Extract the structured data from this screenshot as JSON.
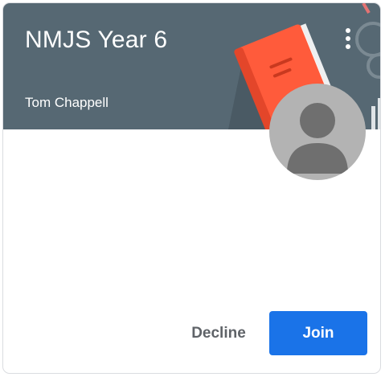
{
  "class_card": {
    "title": "NMJS Year 6",
    "teacher": "Tom Chappell",
    "banner_color": "#566873",
    "more_icon": "more-vert-icon",
    "avatar_icon": "default-avatar-icon",
    "actions": {
      "decline_label": "Decline",
      "join_label": "Join",
      "join_color": "#1a73e8"
    }
  }
}
